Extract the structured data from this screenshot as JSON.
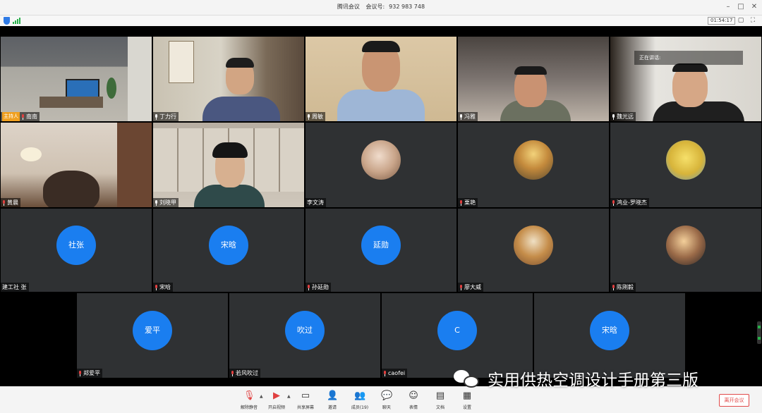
{
  "window": {
    "app_name": "腾讯会议",
    "meeting_label": "会议号:",
    "meeting_id": "932 983 748",
    "timer": "01:54:17"
  },
  "speaking_label": "正在讲话:",
  "host_tag": "主持人",
  "tiles": [
    {
      "name": "南南"
    },
    {
      "name": "丁力行"
    },
    {
      "name": "周敏"
    },
    {
      "name": "冯雅"
    },
    {
      "name": "魏光远"
    },
    {
      "name": "黄晨"
    },
    {
      "name": "刘晓甲"
    },
    {
      "name": "李文涛"
    },
    {
      "name": "栗艳"
    },
    {
      "name": "鸿业-罗晓杰"
    },
    {
      "name": "建工社 张",
      "avatar_text": "社张"
    },
    {
      "name": "宋晗",
      "avatar_text": "宋晗"
    },
    {
      "name": "孙延勋",
      "avatar_text": "延勋"
    },
    {
      "name": "廖大威"
    },
    {
      "name": "陈刚毅"
    },
    {
      "name": "郑爱平",
      "avatar_text": "爱平"
    },
    {
      "name": "若风吹过",
      "avatar_text": "吹过"
    },
    {
      "name": "caofei",
      "avatar_text": "C"
    },
    {
      "name": "宋晗",
      "avatar_text": "宋晗"
    }
  ],
  "toolbar": {
    "mute": "解除静音",
    "video": "开启视频",
    "share": "共享屏幕",
    "invite": "邀请",
    "members": "成员(19)",
    "chat": "聊天",
    "reactions": "表情",
    "docs": "文档",
    "settings": "设置",
    "leave": "离开会议"
  },
  "watermark": "实用供热空调设计手册第三版",
  "colors": {
    "avatar_blue": "#1a7ef0",
    "tile_bg": "#2f3133",
    "leave_red": "#e14a4a",
    "host_tag": "#f0a020"
  }
}
